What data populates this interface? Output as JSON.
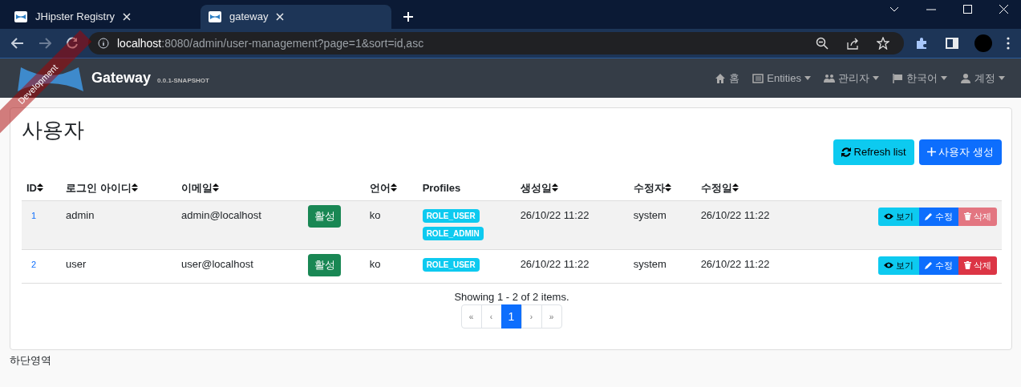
{
  "browser": {
    "tabs": [
      {
        "title": "JHipster Registry",
        "selected": false
      },
      {
        "title": "gateway",
        "selected": true
      }
    ],
    "address": {
      "host": "localhost",
      "rest": ":8080/admin/user-management?page=1&sort=id,asc"
    }
  },
  "navbar": {
    "ribbon": "Development",
    "brand": "Gateway",
    "version": "0.0.1-SNAPSHOT",
    "items": [
      {
        "kind": "home",
        "label": "홈",
        "dropdown": false
      },
      {
        "kind": "entities",
        "label": "Entities",
        "dropdown": true
      },
      {
        "kind": "admin",
        "label": "관리자",
        "dropdown": true
      },
      {
        "kind": "language",
        "label": "한국어",
        "dropdown": true
      },
      {
        "kind": "account",
        "label": "계정",
        "dropdown": true
      }
    ]
  },
  "page": {
    "title": "사용자",
    "refresh_button": "Refresh list",
    "create_button": "사용자 생성"
  },
  "table": {
    "columns": [
      {
        "label": "ID",
        "sortable": true
      },
      {
        "label": "로그인 아이디",
        "sortable": true
      },
      {
        "label": "이메일",
        "sortable": true
      },
      {
        "label": "언어",
        "sortable": true
      },
      {
        "label": "Profiles",
        "sortable": false
      },
      {
        "label": "생성일",
        "sortable": true
      },
      {
        "label": "수정자",
        "sortable": true
      },
      {
        "label": "수정일",
        "sortable": true
      }
    ],
    "rows": [
      {
        "id": "1",
        "login": "admin",
        "email": "admin@localhost",
        "activated": true,
        "status": "활성",
        "lang": "ko",
        "profiles": [
          "ROLE_USER",
          "ROLE_ADMIN"
        ],
        "created": "26/10/22 11:22",
        "modified_by": "system",
        "modified": "26/10/22 11:22",
        "hovered": true,
        "view": "보기",
        "edit": "수정",
        "delete": "삭제",
        "delete_disabled": true
      },
      {
        "id": "2",
        "login": "user",
        "email": "user@localhost",
        "activated": true,
        "status": "활성",
        "lang": "ko",
        "profiles": [
          "ROLE_USER"
        ],
        "created": "26/10/22 11:22",
        "modified_by": "system",
        "modified": "26/10/22 11:22",
        "hovered": false,
        "view": "보기",
        "edit": "수정",
        "delete": "삭제",
        "delete_disabled": false
      }
    ]
  },
  "pagination": {
    "summary": "Showing 1 - 2 of 2 items.",
    "pages": [
      {
        "label": "«",
        "selected": false
      },
      {
        "label": "‹",
        "selected": false
      },
      {
        "label": "1",
        "selected": true
      },
      {
        "label": "›",
        "selected": false
      },
      {
        "label": "»",
        "selected": false
      }
    ]
  },
  "footer": "하단영역"
}
